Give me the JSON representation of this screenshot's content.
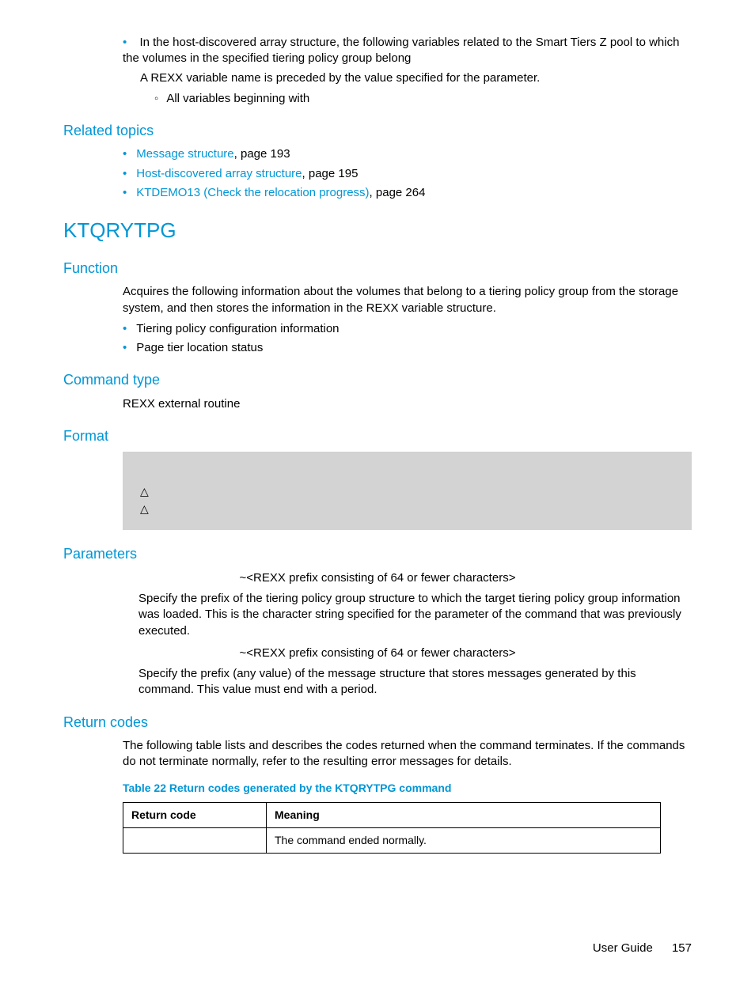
{
  "top_list": {
    "item1_line1": "In the host-discovered array structure, the following variables related to the Smart Tiers Z pool to which the volumes in the specified tiering policy group belong",
    "item1_line2a": "A REXX variable name is preceded by the value specified for the ",
    "item1_line2b": " parameter.",
    "sub1": "All variables beginning with "
  },
  "related": {
    "heading": "Related topics",
    "items": [
      {
        "link": "Message structure",
        "rest": ", page 193"
      },
      {
        "link": "Host-discovered array structure",
        "rest": ", page 195"
      },
      {
        "link": "KTDEMO13 (Check the relocation progress)",
        "rest": ", page 264"
      }
    ]
  },
  "cmd": {
    "title": "KTQRYTPG",
    "function": {
      "heading": "Function",
      "text": "Acquires the following information about the volumes that belong to a tiering policy group from the storage system, and then stores the information in the REXX variable structure.",
      "bullets": [
        "Tiering policy configuration information",
        "Page tier location status"
      ]
    },
    "cmdtype": {
      "heading": "Command type",
      "text": "REXX external routine"
    },
    "format": {
      "heading": "Format",
      "block": "\n△\n△"
    },
    "params": {
      "heading": "Parameters",
      "p1_def": "~<REXX prefix consisting of 64 or fewer characters>",
      "p1_text_a": "Specify the prefix of the tiering policy group structure to which the target tiering policy group information was loaded. This is the character string specified for the ",
      "p1_text_b": " parameter of the command that was previously executed.",
      "p2_def": "~<REXX prefix consisting of 64 or fewer characters>",
      "p2_text": "Specify the prefix (any value) of the message structure that stores messages generated by this command. This value must end with a period."
    },
    "returncodes": {
      "heading": "Return codes",
      "text_a": "The following table lists and describes the codes returned when the ",
      "text_b": " command terminates. If the commands do not terminate normally, refer to the resulting error messages for details.",
      "caption": "Table 22 Return codes generated by the KTQRYTPG command",
      "table": {
        "h1": "Return code",
        "h2": "Meaning",
        "rows": [
          {
            "code": "",
            "meaning": "The command ended normally."
          }
        ]
      }
    }
  },
  "footer": {
    "label": "User Guide",
    "page": "157"
  }
}
